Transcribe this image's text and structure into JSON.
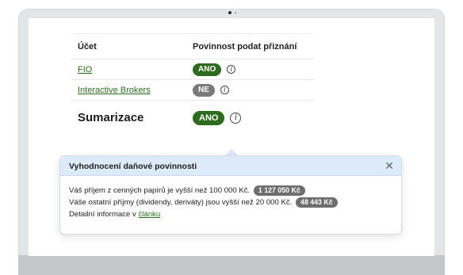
{
  "table": {
    "headers": {
      "account": "Účet",
      "obligation": "Povinnost podat přiznání"
    },
    "rows": [
      {
        "account": "FIO",
        "status": "ANO"
      },
      {
        "account": "Interactive Brokers",
        "status": "NE"
      }
    ],
    "summary": {
      "label": "Sumarizace",
      "status": "ANO"
    }
  },
  "info_icon_glyph": "i",
  "popover": {
    "title": "Vyhodnocení daňové povinnosti",
    "close_glyph": "✕",
    "line1": "Váš příjem z cenných papírů je vyšší než 100 000 Kč.",
    "line1_amount": "1 127 050 Kč",
    "line2": "Váše ostatní příjmy (dividendy, deriváty) jsou vyšší než 20 000 Kč.",
    "line2_amount": "48 443 Kč",
    "line3_prefix": "Detailní informace v",
    "line3_link": "článku"
  },
  "colors": {
    "badge_yes": "#2e6b20",
    "badge_no": "#7a7a7a",
    "link": "#2e6b1f",
    "popover_header": "#ddeafa"
  },
  "icons": {
    "info": "info-circle-icon",
    "close": "close-icon"
  }
}
